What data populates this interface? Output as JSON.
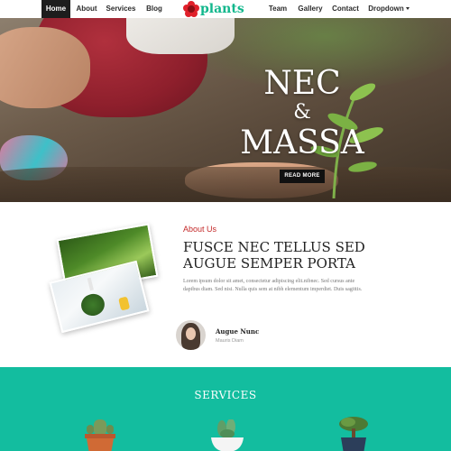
{
  "nav": {
    "items": [
      {
        "label": "Home",
        "active": true
      },
      {
        "label": "About",
        "active": false
      },
      {
        "label": "Services",
        "active": false
      },
      {
        "label": "Blog",
        "active": false
      },
      {
        "label": "Team",
        "active": false
      },
      {
        "label": "Gallery",
        "active": false
      },
      {
        "label": "Contact",
        "active": false
      },
      {
        "label": "Dropdown",
        "active": false
      }
    ],
    "logo_text": "plants",
    "active_bg": "#1d1d1d"
  },
  "hero": {
    "line1": "NEC",
    "line2": "&",
    "line3": "MASSA",
    "button_label": "READ MORE"
  },
  "about": {
    "label": "About Us",
    "title": "FUSCE NEC TELLUS SED AUGUE SEMPER PORTA",
    "text": "Lorem ipsum dolor sit amet, consectetur adipiscing elit.nibnec. Sed cursus ante dapibus diam. Sed nisi. Nulla quis sem at nibh elementum imperdiet. Duis sagittis.",
    "author_name": "Augue Nunc",
    "author_role": "Mauris Diam"
  },
  "services": {
    "title": "SERVICES",
    "bg_color": "#13bd9f"
  },
  "colors": {
    "accent": "#11b78c",
    "logo_flower": "#e0202a",
    "about_label": "#c42a2a"
  }
}
